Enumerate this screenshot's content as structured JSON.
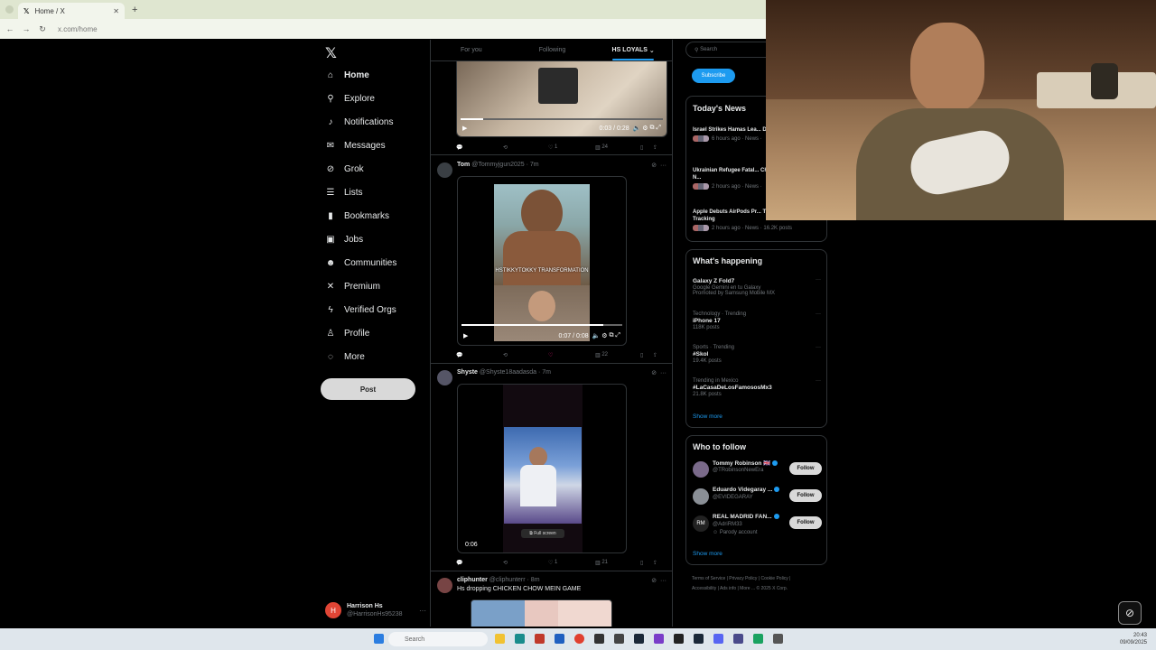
{
  "browser": {
    "tab_title": "Home / X",
    "url": "x.com/home"
  },
  "nav": {
    "items": [
      {
        "label": "Home",
        "icon": "home-icon"
      },
      {
        "label": "Explore",
        "icon": "search-icon"
      },
      {
        "label": "Notifications",
        "icon": "bell-icon"
      },
      {
        "label": "Messages",
        "icon": "mail-icon"
      },
      {
        "label": "Grok",
        "icon": "grok-icon"
      },
      {
        "label": "Lists",
        "icon": "list-icon"
      },
      {
        "label": "Bookmarks",
        "icon": "bookmark-icon"
      },
      {
        "label": "Jobs",
        "icon": "briefcase-icon"
      },
      {
        "label": "Communities",
        "icon": "people-icon"
      },
      {
        "label": "Premium",
        "icon": "x-icon"
      },
      {
        "label": "Verified Orgs",
        "icon": "lightning-icon"
      },
      {
        "label": "Profile",
        "icon": "person-icon"
      },
      {
        "label": "More",
        "icon": "more-circle-icon"
      }
    ],
    "post_label": "Post",
    "profile_name": "Harrison Hs",
    "profile_handle": "@HarrisonHs95238",
    "profile_initial": "H"
  },
  "feed": {
    "tabs": [
      "For you",
      "Following",
      "HS LOYALS"
    ],
    "tweet0": {
      "time": "0:03 / 0:28",
      "likes": "1",
      "views": "24"
    },
    "tweet1": {
      "name": "Tom",
      "handle": "@Tommyjgun2025 · 7m",
      "overlay": "HSTIKKYTOKKY TRANSFORMATION",
      "time": "0:07 / 0:08",
      "views": "22"
    },
    "tweet2": {
      "name": "Shyste",
      "handle": "@Shyste18aadasda · 7m",
      "time": "0:06",
      "fullscreen": "Full screen",
      "likes": "1",
      "views": "21"
    },
    "tweet3": {
      "name": "cliphunter",
      "handle": "@cliphunterr · 8m",
      "text": "Hs dropping CHICKEN CHOW MEIN GAME"
    }
  },
  "right": {
    "search_placeholder": "Search",
    "subscribe_label": "Subscribe",
    "news_title": "Today's News",
    "news": [
      {
        "title": "Israel Strikes Hamas Lea... Doha Assault",
        "meta": "6 hours ago · News ·"
      },
      {
        "title": "Ukrainian Refugee Fatal... Charlotte Train, Fueling N...",
        "meta": "2 hours ago · News ·"
      },
      {
        "title": "Apple Debuts AirPods Pr... Translation and Health Tracking",
        "meta": "2 hours ago · News · 16.2K posts"
      }
    ],
    "happening_title": "What's happening",
    "trends": [
      {
        "ctx": "",
        "name": "Galaxy Z Fold7",
        "sub": "Google Gemini en tu Galaxy",
        "sub2": "Promoted by Samsung Mobile MX"
      },
      {
        "ctx": "Technology · Trending",
        "name": "iPhone 17",
        "sub": "118K posts",
        "sub2": ""
      },
      {
        "ctx": "Sports · Trending",
        "name": "#Skol",
        "sub": "19.4K posts",
        "sub2": ""
      },
      {
        "ctx": "Trending in Mexico",
        "name": "#LaCasaDeLosFamososMx3",
        "sub": "21.8K posts",
        "sub2": ""
      }
    ],
    "show_more": "Show more",
    "wtf_title": "Who to follow",
    "follow": [
      {
        "name": "Tommy Robinson 🇬🇧",
        "handle": "@TRobinsonNewEra",
        "extra": ""
      },
      {
        "name": "Eduardo Videgaray ...",
        "handle": "@EVIDEGARAY",
        "extra": ""
      },
      {
        "name": "REAL MADRID FAN...",
        "handle": "@AdriRM33",
        "extra": "Parody account"
      }
    ],
    "follow_label": "Follow",
    "footer1": "Terms of Service  |  Privacy Policy  |  Cookie Policy  |",
    "footer2": "Accessibility  |  Ads info  |  More ...  © 2025 X Corp."
  },
  "taskbar": {
    "search": "Search",
    "time": "20:43",
    "date": "09/09/2025"
  }
}
